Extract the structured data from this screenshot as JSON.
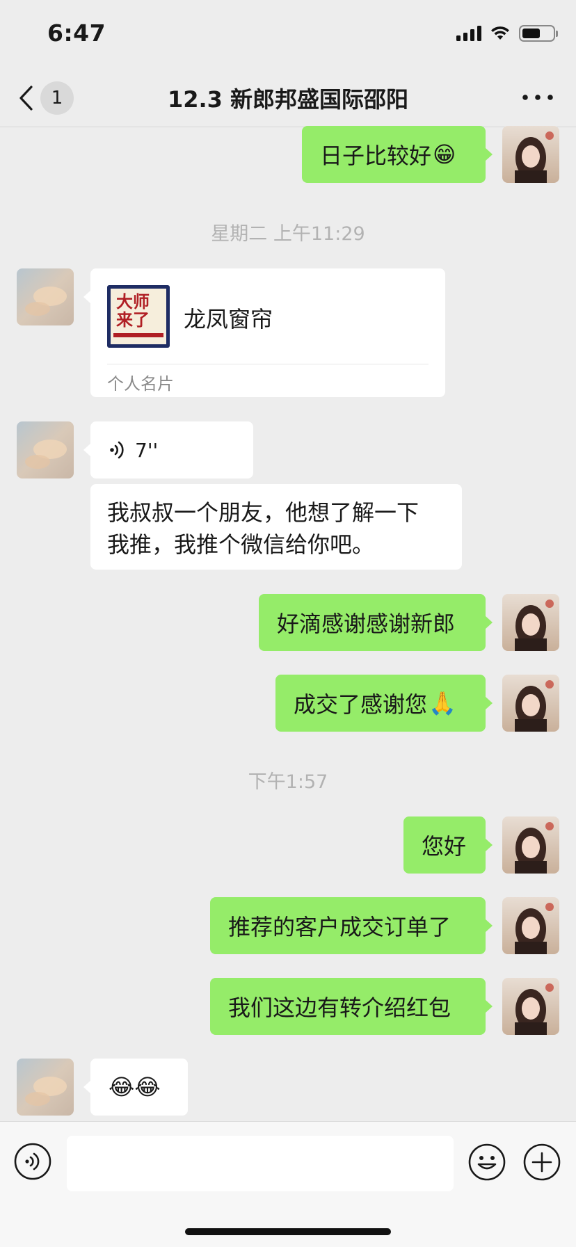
{
  "status_bar": {
    "time": "6:47",
    "battery_level": 0.6
  },
  "nav": {
    "back_count": "1",
    "title": "12.3 新郎邦盛国际邵阳"
  },
  "messages": {
    "m1_text": "日子比较好",
    "m1_emoji": "😁",
    "timestamp1": "星期二 上午11:29",
    "card": {
      "name": "龙凤窗帘",
      "type": "个人名片",
      "thumb_line1": "大师",
      "thumb_line2": "来了"
    },
    "voice_duration": "7''",
    "m3_line1": "我叔叔一个朋友，他想了解一下",
    "m3_line2": "我推，我推个微信给你吧。",
    "m4_text": "好滴感谢感谢新郎",
    "m5_text": "成交了感谢您",
    "m5_emoji": "🙏",
    "timestamp2": "下午1:57",
    "m6_text": "您好",
    "m7_text": "推荐的客户成交订单了",
    "m8_text": "我们这边有转介绍红包",
    "m9_emoji": "😂😂"
  },
  "input": {
    "placeholder": ""
  },
  "colors": {
    "background": "#ededed",
    "sent_bubble": "#95ec69",
    "received_bubble": "#ffffff",
    "timestamp": "#b2b2b2"
  }
}
